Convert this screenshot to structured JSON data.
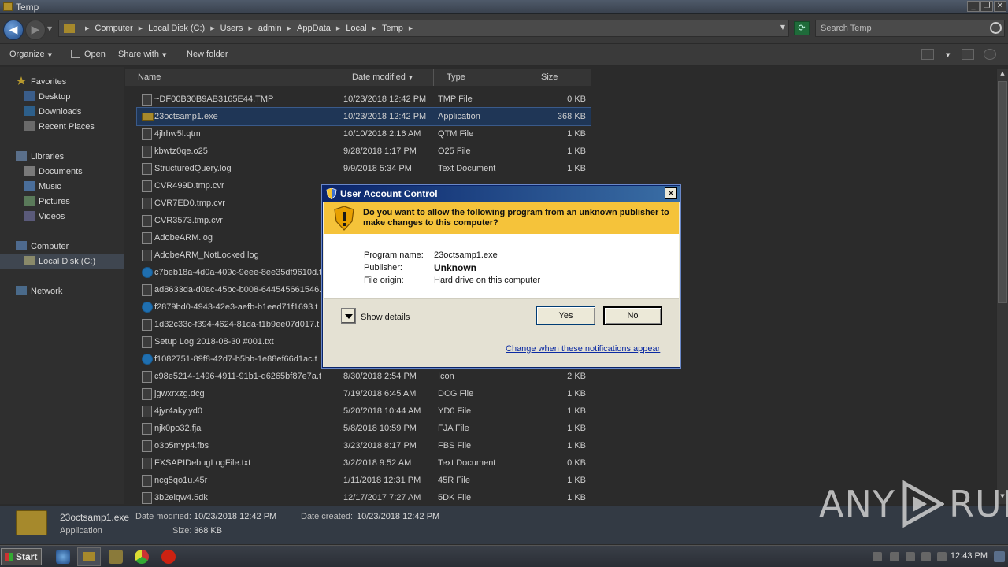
{
  "window": {
    "title": "Temp",
    "controls": [
      "_",
      "❐",
      "✕"
    ]
  },
  "address": {
    "back_glyph": "◀",
    "forward_glyph": "▶",
    "breadcrumbs": [
      "Computer",
      "Local Disk (C:)",
      "Users",
      "admin",
      "AppData",
      "Local",
      "Temp"
    ],
    "search_placeholder": "Search Temp"
  },
  "toolbar": {
    "organize": "Organize",
    "open": "Open",
    "share_with": "Share with",
    "new_folder": "New folder"
  },
  "nav": {
    "favorites": "Favorites",
    "desktop": "Desktop",
    "downloads": "Downloads",
    "recent_places": "Recent Places",
    "libraries": "Libraries",
    "documents": "Documents",
    "music": "Music",
    "pictures": "Pictures",
    "videos": "Videos",
    "computer": "Computer",
    "local_disk": "Local Disk (C:)",
    "network": "Network"
  },
  "columns": {
    "name": "Name",
    "date_modified": "Date modified",
    "type": "Type",
    "size": "Size"
  },
  "files": [
    {
      "name": "~DF00B30B9AB3165E44.TMP",
      "date": "10/23/2018 12:42 PM",
      "type": "TMP File",
      "size": "0 KB",
      "icon": "file-icon"
    },
    {
      "name": "23octsamp1.exe",
      "date": "10/23/2018 12:42 PM",
      "type": "Application",
      "size": "368 KB",
      "icon": "folder-icon",
      "selected": true
    },
    {
      "name": "4jlrhw5l.qtm",
      "date": "10/10/2018 2:16 AM",
      "type": "QTM File",
      "size": "1 KB",
      "icon": "file-icon"
    },
    {
      "name": "kbwtz0qe.o25",
      "date": "9/28/2018 1:17 PM",
      "type": "O25 File",
      "size": "1 KB",
      "icon": "file-icon"
    },
    {
      "name": "StructuredQuery.log",
      "date": "9/9/2018 5:34 PM",
      "type": "Text Document",
      "size": "1 KB",
      "icon": "file-icon"
    },
    {
      "name": "CVR499D.tmp.cvr",
      "date": "",
      "type": "",
      "size": "",
      "icon": "file-icon"
    },
    {
      "name": "CVR7ED0.tmp.cvr",
      "date": "",
      "type": "",
      "size": "",
      "icon": "file-icon"
    },
    {
      "name": "CVR3573.tmp.cvr",
      "date": "",
      "type": "",
      "size": "",
      "icon": "file-icon"
    },
    {
      "name": "AdobeARM.log",
      "date": "",
      "type": "",
      "size": "",
      "icon": "file-icon"
    },
    {
      "name": "AdobeARM_NotLocked.log",
      "date": "",
      "type": "",
      "size": "",
      "icon": "file-icon"
    },
    {
      "name": "c7beb18a-4d0a-409c-9eee-8ee35df9610d.t",
      "date": "",
      "type": "",
      "size": "",
      "icon": "skype-icon"
    },
    {
      "name": "ad8633da-d0ac-45bc-b008-644545661546.t",
      "date": "",
      "type": "",
      "size": "",
      "icon": "file-icon"
    },
    {
      "name": "f2879bd0-4943-42e3-aefb-b1eed71f1693.t",
      "date": "",
      "type": "",
      "size": "",
      "icon": "skype-icon"
    },
    {
      "name": "1d32c33c-f394-4624-81da-f1b9ee07d017.t",
      "date": "",
      "type": "",
      "size": "",
      "icon": "file-icon"
    },
    {
      "name": "Setup Log 2018-08-30 #001.txt",
      "date": "",
      "type": "",
      "size": "",
      "icon": "file-icon"
    },
    {
      "name": "f1082751-89f8-42d7-b5bb-1e88ef66d1ac.t",
      "date": "",
      "type": "",
      "size": "",
      "icon": "skype-icon"
    },
    {
      "name": "c98e5214-1496-4911-91b1-d6265bf87e7a.t",
      "date": "8/30/2018 2:54 PM",
      "type": "Icon",
      "size": "2 KB",
      "icon": "file-icon"
    },
    {
      "name": "jgwxrxzg.dcg",
      "date": "7/19/2018 6:45 AM",
      "type": "DCG File",
      "size": "1 KB",
      "icon": "file-icon"
    },
    {
      "name": "4jyr4aky.yd0",
      "date": "5/20/2018 10:44 AM",
      "type": "YD0 File",
      "size": "1 KB",
      "icon": "file-icon"
    },
    {
      "name": "njk0po32.fja",
      "date": "5/8/2018 10:59 PM",
      "type": "FJA File",
      "size": "1 KB",
      "icon": "file-icon"
    },
    {
      "name": "o3p5myp4.fbs",
      "date": "3/23/2018 8:17 PM",
      "type": "FBS File",
      "size": "1 KB",
      "icon": "file-icon"
    },
    {
      "name": "FXSAPIDebugLogFile.txt",
      "date": "3/2/2018 9:52 AM",
      "type": "Text Document",
      "size": "0 KB",
      "icon": "file-icon"
    },
    {
      "name": "ncg5qo1u.45r",
      "date": "1/11/2018 12:31 PM",
      "type": "45R File",
      "size": "1 KB",
      "icon": "file-icon"
    },
    {
      "name": "3b2eiqw4.5dk",
      "date": "12/17/2017 7:27 AM",
      "type": "5DK File",
      "size": "1 KB",
      "icon": "file-icon"
    }
  ],
  "details": {
    "name": "23octsamp1.exe",
    "type": "Application",
    "date_modified_label": "Date modified:",
    "date_modified": "10/23/2018 12:42 PM",
    "date_created_label": "Date created:",
    "date_created": "10/23/2018 12:42 PM",
    "size_label": "Size:",
    "size": "368 KB"
  },
  "uac": {
    "title": "User Account Control",
    "close": "✕",
    "question": "Do you want to allow the following program from an unknown publisher to make changes to this computer?",
    "program_name_label": "Program name:",
    "program_name": "23octsamp1.exe",
    "publisher_label": "Publisher:",
    "publisher": "Unknown",
    "origin_label": "File origin:",
    "origin": "Hard drive on this computer",
    "show_details": "Show details",
    "yes": "Yes",
    "no": "No",
    "link": "Change when these notifications appear"
  },
  "taskbar": {
    "start": "Start",
    "clock": "12:43 PM"
  },
  "watermark": {
    "left": "ANY",
    "right": "RUN"
  },
  "colors": {
    "uac_banner": "#f5c33a",
    "selection": "#1f3656",
    "link": "#0b2aa3"
  }
}
